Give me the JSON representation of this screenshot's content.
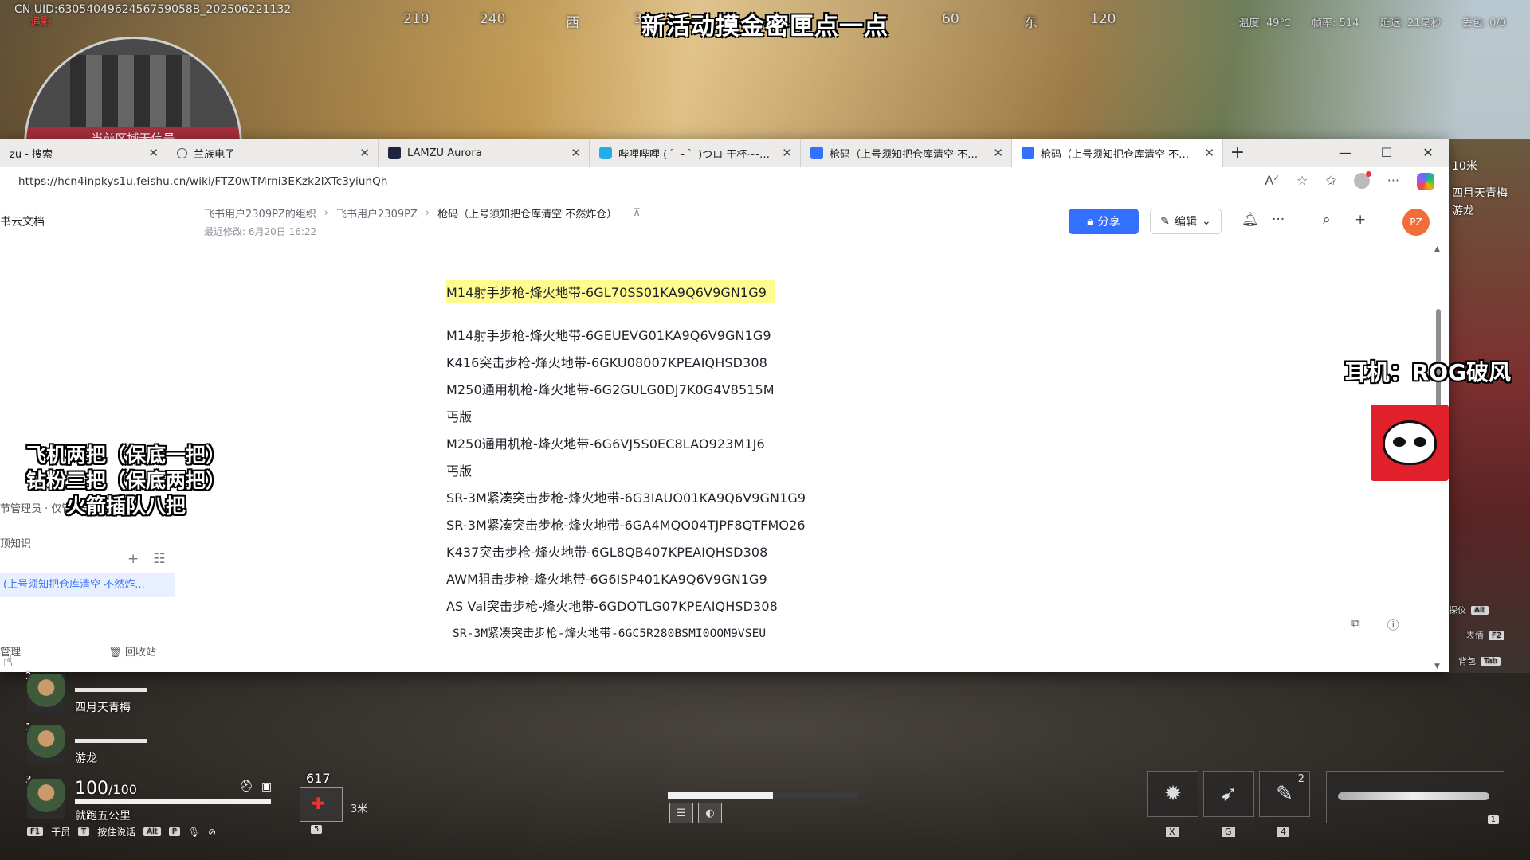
{
  "hud": {
    "uid": "CN UID:6305404962456759058B_202506221132",
    "uid_mark": "追影",
    "event_title": "新活动摸金密匣点一点",
    "compass": [
      "210",
      "240",
      "西",
      "3",
      "60",
      "东",
      "120"
    ],
    "top_right": [
      "温度: 49℃",
      "帧率: 514",
      "延迟: 21毫秒",
      "丢包: 0/0"
    ],
    "minimap_nosignal": "当前区域无信号"
  },
  "browser": {
    "tabs": [
      {
        "label": "zu - 搜索",
        "icon": "search-icon"
      },
      {
        "label": "兰族电子",
        "icon": "globe-icon"
      },
      {
        "label": "LAMZU Aurora",
        "icon": "lamzu-icon"
      },
      {
        "label": "哔哩哔哩 ( ゜- ゜)つロ 干杯~-bilibili",
        "icon": "bilibili-icon"
      },
      {
        "label": "枪码（上号须知把仓库清空 不然炸仓）",
        "icon": "doc-icon"
      },
      {
        "label": "枪码（上号须知把仓库清空 不然炸仓）",
        "icon": "doc-icon"
      }
    ],
    "url": "https://hcn4inpkys1u.feishu.cn/wiki/FTZ0wTMrni3EKzk2lXTc3yiunQh",
    "controls": {
      "minimize": "—",
      "maximize": "☐",
      "close": "✕"
    }
  },
  "doc": {
    "sidebar_title": "书云文档",
    "breadcrumb": [
      "飞书用户2309PZ的组织",
      "飞书用户2309PZ",
      "枪码（上号须知把仓库清空 不然炸仓）"
    ],
    "last_modified": "最近修改: 6月20日 16:22",
    "share_label": "分享",
    "edit_label": "编辑",
    "user_initials": "PZ",
    "sidebar_manage": "节管理员 · 仅管理员可编辑",
    "sidebar_knowledge": "顶知识",
    "sidebar_active_item": "(上号须知把仓库清空 不然炸...",
    "sidebar_footer_left": "管理",
    "sidebar_footer_right": "回收站",
    "lines": [
      "M14射手步枪-烽火地带-6GL70SS01KA9Q6V9GN1G9",
      "M14射手步枪-烽火地带-6GEUEVG01KA9Q6V9GN1G9",
      "K416突击步枪-烽火地带-6GKU08007KPEAIQHSD308",
      "M250通用机枪-烽火地带-6G2GULG0DJ7K0G4V8515M",
      "丐版",
      "M250通用机枪-烽火地带-6G6VJ5S0EC8LAO923M1J6",
      "丐版",
      "SR-3M紧凑突击步枪-烽火地带-6G3IAUO01KA9Q6V9GN1G9",
      "SR-3M紧凑突击步枪-烽火地带-6GA4MQO04TJPF8QTFMO26",
      "K437突击步枪-烽火地带-6GL8QB407KPEAIQHSD308",
      "AWM狙击步枪-烽火地带-6G6ISP401KA9Q6V9GN1G9",
      "AS Val突击步枪-烽火地带-6GDOTLG07KPEAIQHSD308",
      "SR-3M紧凑突击步枪-烽火地带-6GC5R280BSMI0OOM9VSEU"
    ]
  },
  "overlay": {
    "notes": [
      "飞机两把（保底一把）",
      "钻粉三把（保底两把）",
      "火箭插队八把"
    ],
    "headset": "耳机：ROG破风"
  },
  "side_right": {
    "distance": "10米",
    "names": [
      "四月天青梅",
      "游龙"
    ],
    "keys": [
      {
        "label": "探仪",
        "key": "Alt"
      },
      {
        "label": "表情",
        "key": "F2"
      },
      {
        "label": "背包",
        "key": "Tab"
      }
    ]
  },
  "bottom": {
    "teammates": [
      {
        "index": "2",
        "name": "四月天青梅"
      },
      {
        "index": "1",
        "name": "游龙"
      }
    ],
    "player_index": "3",
    "hp_current": "100",
    "hp_max": "/100",
    "player_name": "就跑五公里",
    "key_hints": [
      {
        "key": "F1",
        "label": "干员"
      },
      {
        "key": "T",
        "label": "按住说话"
      },
      {
        "key": "Alt",
        "label": ""
      },
      {
        "key": "P",
        "label": ""
      }
    ],
    "ammo": "617",
    "item_distance": "3米",
    "item_key": "5",
    "skill_keys": [
      "X",
      "G",
      "4"
    ],
    "skill_badge": "2",
    "weapon_key": "1",
    "center_bar_fill": 0.55
  }
}
